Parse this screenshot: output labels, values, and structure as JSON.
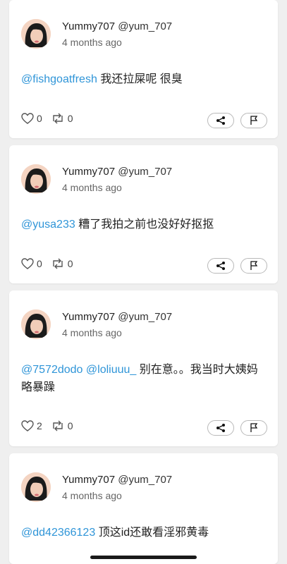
{
  "posts": [
    {
      "display_name": "Yummy707",
      "handle": "@yum_707",
      "time": "4 months ago",
      "mentions": [
        "@fishgoatfresh"
      ],
      "text": "我还拉屎呢 很臭",
      "likes": "0",
      "reposts": "0"
    },
    {
      "display_name": "Yummy707",
      "handle": "@yum_707",
      "time": "4 months ago",
      "mentions": [
        "@yusa233"
      ],
      "text": "糟了我拍之前也没好好抠抠",
      "likes": "0",
      "reposts": "0"
    },
    {
      "display_name": "Yummy707",
      "handle": "@yum_707",
      "time": "4 months ago",
      "mentions": [
        "@7572dodo",
        "@loliuuu_"
      ],
      "text": "别在意。。我当时大姨妈略暴躁",
      "likes": "2",
      "reposts": "0"
    },
    {
      "display_name": "Yummy707",
      "handle": "@yum_707",
      "time": "4 months ago",
      "mentions": [
        "@dd42366123"
      ],
      "text": "顶这id还敢看淫邪黄毒"
    }
  ]
}
